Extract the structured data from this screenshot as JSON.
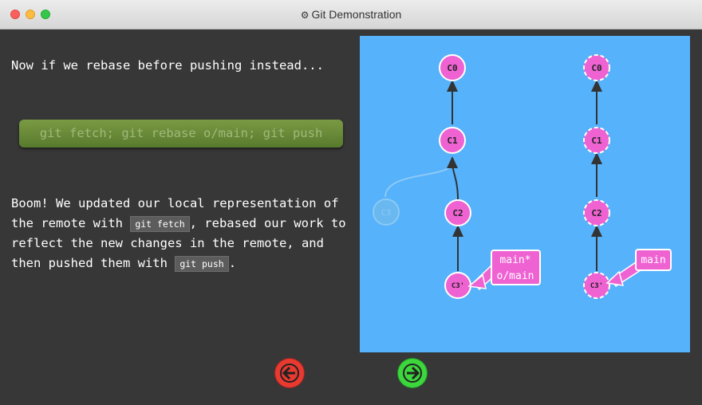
{
  "window": {
    "title": "Git Demonstration",
    "title_icon": "gear-icon"
  },
  "lesson": {
    "intro": "Now if we rebase before pushing instead...",
    "command": "git fetch; git rebase o/main; git push",
    "result_part1": "Boom! We updated our local representation of the remote with ",
    "code1": "git fetch",
    "result_part2": ", rebased our work to reflect the new changes in the remote, and then pushed them with ",
    "code2": "git push",
    "result_part3": "."
  },
  "graph": {
    "local_commits": [
      "C0",
      "C1",
      "C2",
      "C3'"
    ],
    "orphan_commit": "C3",
    "remote_commits": [
      "C0",
      "C1",
      "C2",
      "C3'"
    ],
    "local_branch_label_line1": "main*",
    "local_branch_label_line2": "o/main",
    "remote_branch_label": "main"
  },
  "colors": {
    "commit_fill": "#ef62d2",
    "canvas": "#55b2fb",
    "command_button": "#6d8c3a",
    "back_button": "#e83a30",
    "forward_button": "#3dd63d"
  },
  "nav": {
    "back_icon": "arrow-left-icon",
    "forward_icon": "arrow-right-icon"
  }
}
